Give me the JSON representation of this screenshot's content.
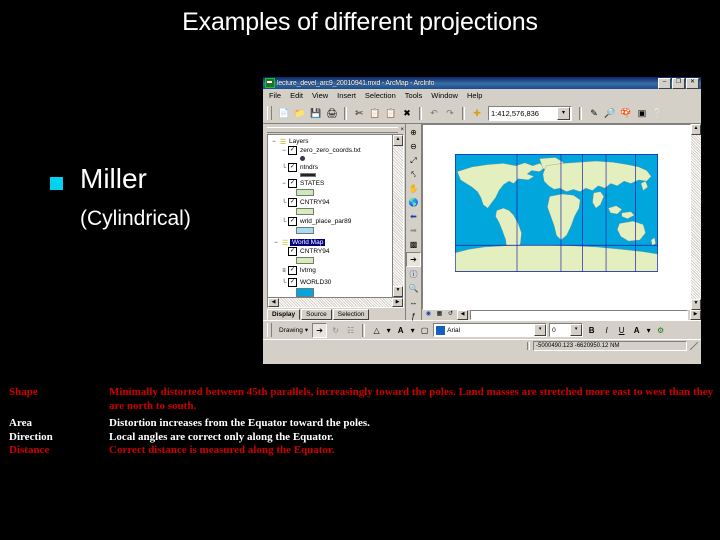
{
  "slide": {
    "title": "Examples of different projections",
    "bullet_label": "Miller",
    "bullet_sub": "(Cylindrical)",
    "bullet_color": "#00d2f0"
  },
  "properties": {
    "rows": [
      {
        "label": "Shape",
        "value": "Minimally distorted between 45th parallels, increasingly toward the poles. Land masses are stretched more east to west than they are north to south.",
        "color": "#cc0000"
      },
      {
        "label": "Area",
        "value": "Distortion increases from the Equator toward the poles.",
        "color": "#ffffff"
      },
      {
        "label": "Direction",
        "value": "Local angles are correct only along the Equator.",
        "color": "#ffffff"
      },
      {
        "label": "Distance",
        "value": "Correct distance is measured along the Equator.",
        "color": "#cc0000"
      }
    ]
  },
  "arcmap": {
    "window_title": "lecture_devel_arc9_20010941.mxd - ArcMap - ArcInfo",
    "window_buttons": [
      "–",
      "❐",
      "✕"
    ],
    "menus": [
      "File",
      "Edit",
      "View",
      "Insert",
      "Selection",
      "Tools",
      "Window",
      "Help"
    ],
    "toolbar_icons": [
      "new-document-icon",
      "open-folder-icon",
      "save-icon",
      "print-icon",
      "cut-icon",
      "copy-icon",
      "paste-icon",
      "delete-icon",
      "undo-icon",
      "redo-icon",
      "add-data-icon"
    ],
    "scale": {
      "value": "1:412,576,836",
      "dropdown_glyph": "▾"
    },
    "toolbar_icons_right": [
      "editor-toolbar-icon",
      "map-tips-icon",
      "arctoolbox-icon",
      "show-hide-toc-icon",
      "whats-this-help-icon"
    ],
    "toc": {
      "close_glyph": "×",
      "nodes": [
        {
          "indent": 0,
          "expander": "−",
          "checkbox": "",
          "icon": "data-frame-icon",
          "label": "Layers",
          "swatch": null,
          "selected": false
        },
        {
          "indent": 1,
          "expander": "−",
          "checkbox": "✓",
          "icon": "point-layer-icon",
          "label": "zero_zero_coords.txt",
          "swatch": null,
          "selected": false
        },
        {
          "indent": 1,
          "expander": "└",
          "checkbox": "✓",
          "icon": "line-layer-icon",
          "label": "ntndrs",
          "swatch": "#ffffff",
          "selected": false
        },
        {
          "indent": 1,
          "expander": "−",
          "checkbox": "✓",
          "icon": "poly-layer-icon",
          "label": "STATES",
          "swatch": "#cfe8b8",
          "selected": false
        },
        {
          "indent": 1,
          "expander": "└",
          "checkbox": "✓",
          "icon": "poly-layer-icon",
          "label": "CNTRY94",
          "swatch": "#d8ecb8",
          "selected": false
        },
        {
          "indent": 1,
          "expander": "└",
          "checkbox": "✓",
          "icon": "poly-layer-icon",
          "label": "wrld_place_par89",
          "swatch": "#a8dcf0",
          "selected": false
        },
        {
          "indent": 0,
          "expander": "−",
          "checkbox": "",
          "icon": "data-frame-icon",
          "label": "World Map",
          "swatch": null,
          "selected": true
        },
        {
          "indent": 1,
          "expander": "",
          "checkbox": "✓",
          "icon": "poly-layer-icon",
          "label": "CNTRY94",
          "swatch": "#d8ecb8",
          "selected": false
        },
        {
          "indent": 1,
          "expander": "≡",
          "checkbox": "✓",
          "icon": "line-layer-icon",
          "label": "lvtrng",
          "swatch": null,
          "selected": false
        },
        {
          "indent": 1,
          "expander": "└",
          "checkbox": "✓",
          "icon": "poly-layer-icon",
          "label": "WORLD30",
          "swatch": "#00a6dc"
        }
      ],
      "tabs": [
        "Display",
        "Source",
        "Selection"
      ],
      "active_tab": "Display"
    },
    "tools": [
      "zoom-in-icon",
      "zoom-out-icon",
      "pan-icon",
      "full-extent-icon",
      "fixed-zoom-icon",
      "globe-icon",
      "back-extent-icon",
      "forward-extent-icon",
      "select-features-icon",
      "select-elements-icon",
      "identify-icon",
      "find-icon",
      "measure-icon",
      "hyperlink-icon"
    ],
    "map": {
      "ocean_color": "#00a6dc",
      "land_color": "#e4efc0",
      "border_color": "#8a8a8a",
      "graticule_color": "#1a1aaa",
      "background_color": "#ffffff"
    },
    "draw_toolbar": {
      "drawing_label": "Drawing",
      "dropdown_glyph": "▾",
      "select_icon": "select-arrow-icon",
      "rotate_icon": "rotate-icon",
      "group_icon": "group-icon",
      "shape_icon": "new-shape-icon",
      "text_icon": "text-color-icon",
      "newtext_icon": "new-text-icon",
      "font_name": "Arial",
      "font_size": "0",
      "bold_label": "B",
      "italic_label": "I",
      "underline_label": "U",
      "font_color_label": "A",
      "fill_icon": "fill-color-icon"
    },
    "status_coordinates": "-5000490.123  -6620950.12 NM"
  }
}
